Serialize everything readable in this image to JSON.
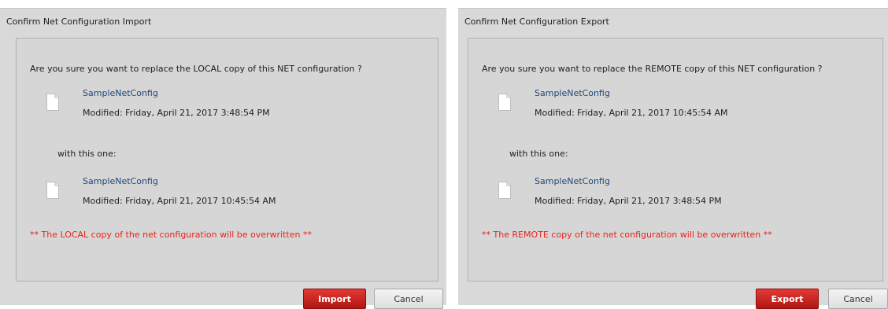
{
  "import_dialog": {
    "title": "Confirm Net Configuration Import",
    "question": "Are you sure you want to replace the LOCAL copy of this NET configuration ?",
    "current_file": {
      "name": "SampleNetConfig",
      "modified": "Modified: Friday, April 21, 2017 3:48:54 PM",
      "icon": "file-icon"
    },
    "with_text": "with this one:",
    "new_file": {
      "name": "SampleNetConfig",
      "modified": "Modified: Friday, April 21, 2017 10:45:54 AM",
      "icon": "file-icon"
    },
    "warning": "** The LOCAL copy of the net configuration will be overwritten **",
    "primary_button": "Import",
    "cancel_button": "Cancel"
  },
  "export_dialog": {
    "title": "Confirm Net Configuration Export",
    "question": "Are you sure you want to replace the REMOTE copy of this NET configuration ?",
    "current_file": {
      "name": "SampleNetConfig",
      "modified": "Modified: Friday, April 21, 2017 10:45:54 AM",
      "icon": "file-icon"
    },
    "with_text": "with this one:",
    "new_file": {
      "name": "SampleNetConfig",
      "modified": "Modified: Friday, April 21, 2017 3:48:54 PM",
      "icon": "file-icon"
    },
    "warning": "** The REMOTE copy of the net configuration will be overwritten **",
    "primary_button": "Export",
    "cancel_button": "Cancel"
  },
  "colors": {
    "dialog_bg": "#d9d9d9",
    "link_blue": "#24467a",
    "warning_red": "#e8231c",
    "primary_button_red": "#c8201c"
  }
}
